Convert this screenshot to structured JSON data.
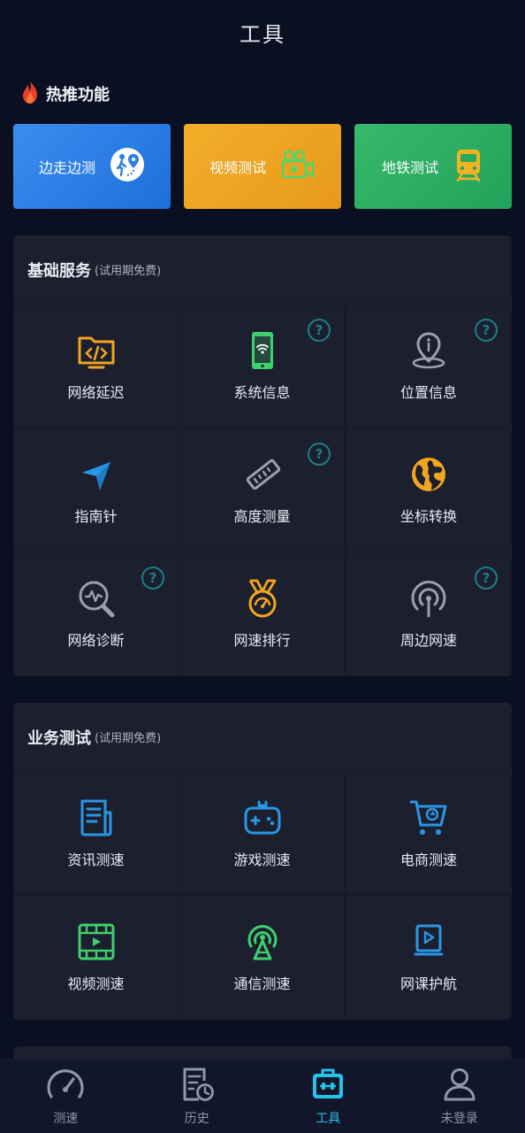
{
  "header": {
    "title": "工具"
  },
  "hot": {
    "label": "热推功能",
    "cards": [
      {
        "label": "边走边测",
        "icon": "walk-location-icon"
      },
      {
        "label": "视频测试",
        "icon": "video-camera-icon"
      },
      {
        "label": "地铁测试",
        "icon": "subway-train-icon"
      }
    ]
  },
  "basic": {
    "title": "基础服务",
    "subtitle": "(试用期免费)",
    "items": [
      {
        "label": "网络延迟",
        "icon": "folder-code-icon"
      },
      {
        "label": "系统信息",
        "icon": "phone-wifi-icon"
      },
      {
        "label": "位置信息",
        "icon": "location-info-icon"
      },
      {
        "label": "指南针",
        "icon": "compass-arrow-icon"
      },
      {
        "label": "高度测量",
        "icon": "ruler-icon"
      },
      {
        "label": "坐标转换",
        "icon": "globe-icon"
      },
      {
        "label": "网络诊断",
        "icon": "magnifier-wave-icon"
      },
      {
        "label": "网速排行",
        "icon": "medal-speed-icon"
      },
      {
        "label": "周边网速",
        "icon": "signal-tower-icon"
      }
    ],
    "help_mark": "?"
  },
  "business": {
    "title": "业务测试",
    "subtitle": "(试用期免费)",
    "items": [
      {
        "label": "资讯测速",
        "icon": "news-document-icon"
      },
      {
        "label": "游戏测速",
        "icon": "gamepad-icon"
      },
      {
        "label": "电商测速",
        "icon": "shopping-cart-icon"
      },
      {
        "label": "视频测速",
        "icon": "film-play-icon"
      },
      {
        "label": "通信测速",
        "icon": "antenna-broadcast-icon"
      },
      {
        "label": "网课护航",
        "icon": "online-class-icon"
      }
    ]
  },
  "tabbar": {
    "items": [
      {
        "label": "测速",
        "icon": "speedometer-icon"
      },
      {
        "label": "历史",
        "icon": "history-document-icon"
      },
      {
        "label": "工具",
        "icon": "toolbox-icon"
      },
      {
        "label": "未登录",
        "icon": "user-icon"
      }
    ],
    "active_index": 2
  },
  "colors": {
    "background": "#0b0f22",
    "card": "#1b1f2e",
    "accent": "#26c2ea",
    "orange": "#f2a51f",
    "green": "#3ecf6e",
    "blue": "#2a97e6",
    "gray_icon": "#9aa0ad"
  }
}
